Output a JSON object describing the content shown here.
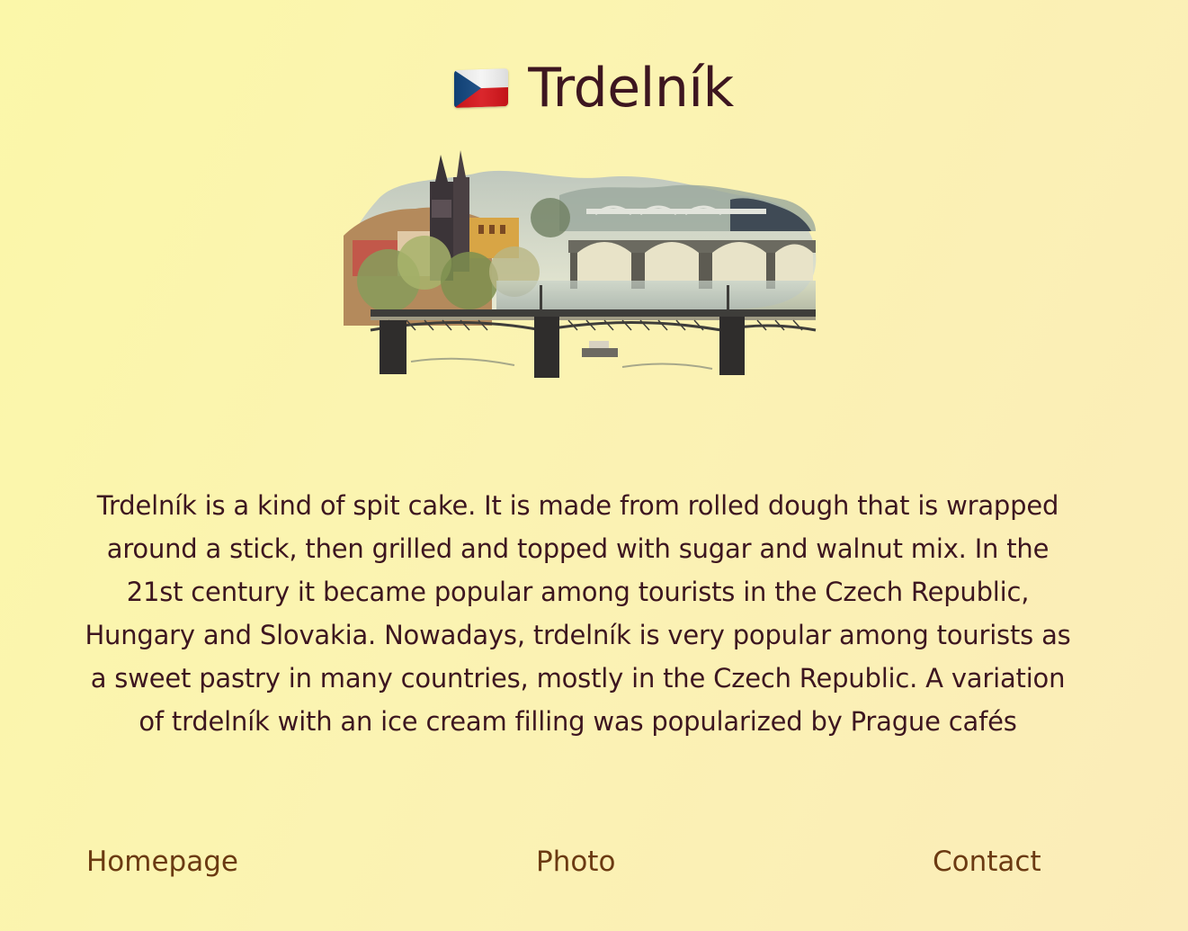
{
  "header": {
    "flag_icon": "czech-flag-icon",
    "title": "Trdelník"
  },
  "illustration": {
    "icon": "prague-bridges-illustration"
  },
  "main": {
    "description": "Trdelník is a kind of spit cake. It is made from rolled dough that is wrapped around a stick, then grilled and topped with sugar and walnut mix. In the 21st century it became popular among tourists in the Czech Republic, Hungary and Slovakia. Nowadays, trdelník is very popular among tourists as a sweet pastry in many countries, mostly in the Czech Republic. A variation of trdelník with an ice cream filling was popularized by Prague cafés"
  },
  "nav": {
    "items": [
      {
        "label": "Homepage"
      },
      {
        "label": "Photo"
      },
      {
        "label": "Contact"
      }
    ]
  },
  "colors": {
    "background_start": "#fbf7a9",
    "background_end": "#fbecb9",
    "title_text": "#3d1620",
    "nav_link": "#6b3a12"
  }
}
